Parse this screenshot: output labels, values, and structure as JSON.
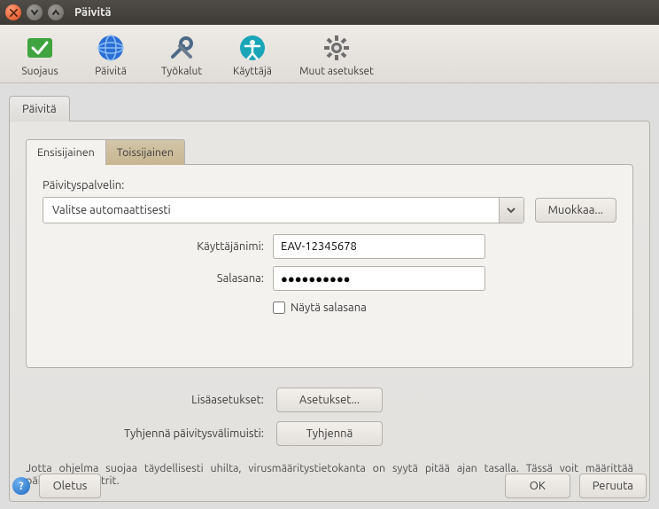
{
  "window": {
    "title": "Päivitä"
  },
  "toolbar": {
    "items": [
      {
        "label": "Suojaus"
      },
      {
        "label": "Päivitä"
      },
      {
        "label": "Työkalut"
      },
      {
        "label": "Käyttäjä"
      },
      {
        "label": "Muut asetukset"
      }
    ]
  },
  "outer_tabs": {
    "active": "Päivitä"
  },
  "inner_tabs": {
    "primary": "Ensisijainen",
    "secondary": "Toissijainen"
  },
  "server": {
    "label": "Päivityspalvelin:",
    "selected": "Valitse automaattisesti",
    "edit_btn": "Muokkaa..."
  },
  "credentials": {
    "username_label": "Käyttäjänimi:",
    "username_value": "EAV-12345678",
    "password_label": "Salasana:",
    "password_value": "●●●●●●●●●●",
    "show_password_label": "Näytä salasana"
  },
  "extra": {
    "advanced_label": "Lisäasetukset:",
    "advanced_btn": "Asetukset...",
    "clear_label": "Tyhjennä päivitysvälimuisti:",
    "clear_btn": "Tyhjennä"
  },
  "footer_note": "Jotta ohjelma suojaa täydellisesti uhilta, virusmääritystietokanta on syytä pitää ajan tasalla. Tässä voit määrittää päivitysparametrit.",
  "bottom": {
    "defaults_btn": "Oletus",
    "ok_btn": "OK",
    "cancel_btn": "Peruuta"
  }
}
